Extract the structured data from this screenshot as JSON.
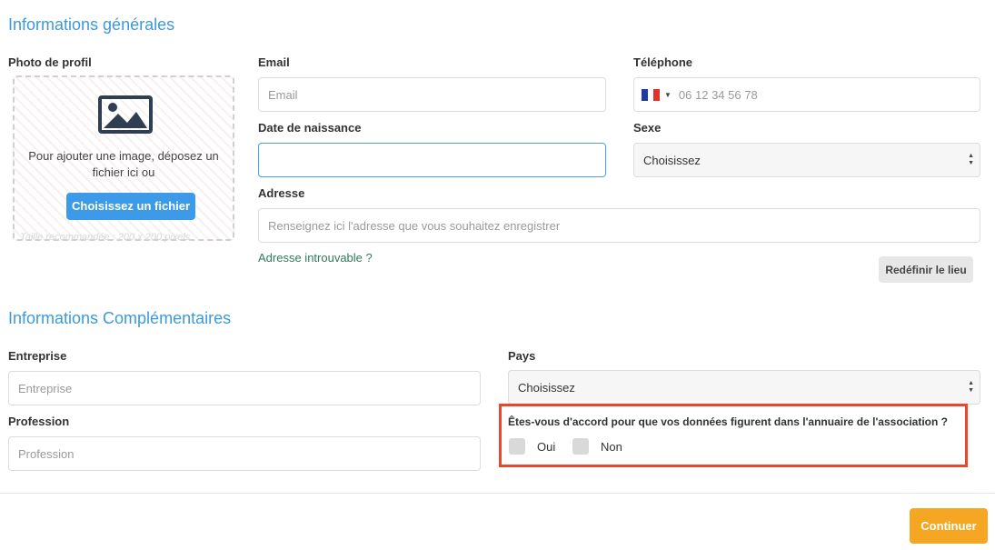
{
  "sections": {
    "general_title": "Informations générales",
    "complementary_title": "Informations Complémentaires"
  },
  "profile_photo": {
    "label": "Photo de profil",
    "drop_text": "Pour ajouter une image, déposez un fichier ici ou",
    "choose_button": "Choisissez un fichier",
    "hint": "Taille recommandée : 200 x 200 pixels",
    "icon": "image-icon"
  },
  "email": {
    "label": "Email",
    "placeholder": "Email",
    "value": ""
  },
  "phone": {
    "label": "Téléphone",
    "placeholder": "06 12 34 56 78",
    "country_flag": "france-flag-icon"
  },
  "birthdate": {
    "label": "Date de naissance",
    "value": ""
  },
  "sex": {
    "label": "Sexe",
    "selected": "Choisissez"
  },
  "address": {
    "label": "Adresse",
    "placeholder": "Renseignez ici l'adresse que vous souhaitez enregistrer",
    "not_found_link": "Adresse introuvable ?",
    "redefine_button": "Redéfinir le lieu"
  },
  "company": {
    "label": "Entreprise",
    "placeholder": "Entreprise"
  },
  "country": {
    "label": "Pays",
    "selected": "Choisissez"
  },
  "profession": {
    "label": "Profession",
    "placeholder": "Profession"
  },
  "consent": {
    "question": "Êtes-vous d'accord pour que vos données figurent dans l'annuaire de l'association ?",
    "yes": "Oui",
    "no": "Non"
  },
  "footer": {
    "continue_button": "Continuer"
  },
  "colors": {
    "accent": "#3d9ad9",
    "button_blue": "#3d9ae8",
    "continue": "#f5a623",
    "highlight_border": "#e8472b"
  }
}
